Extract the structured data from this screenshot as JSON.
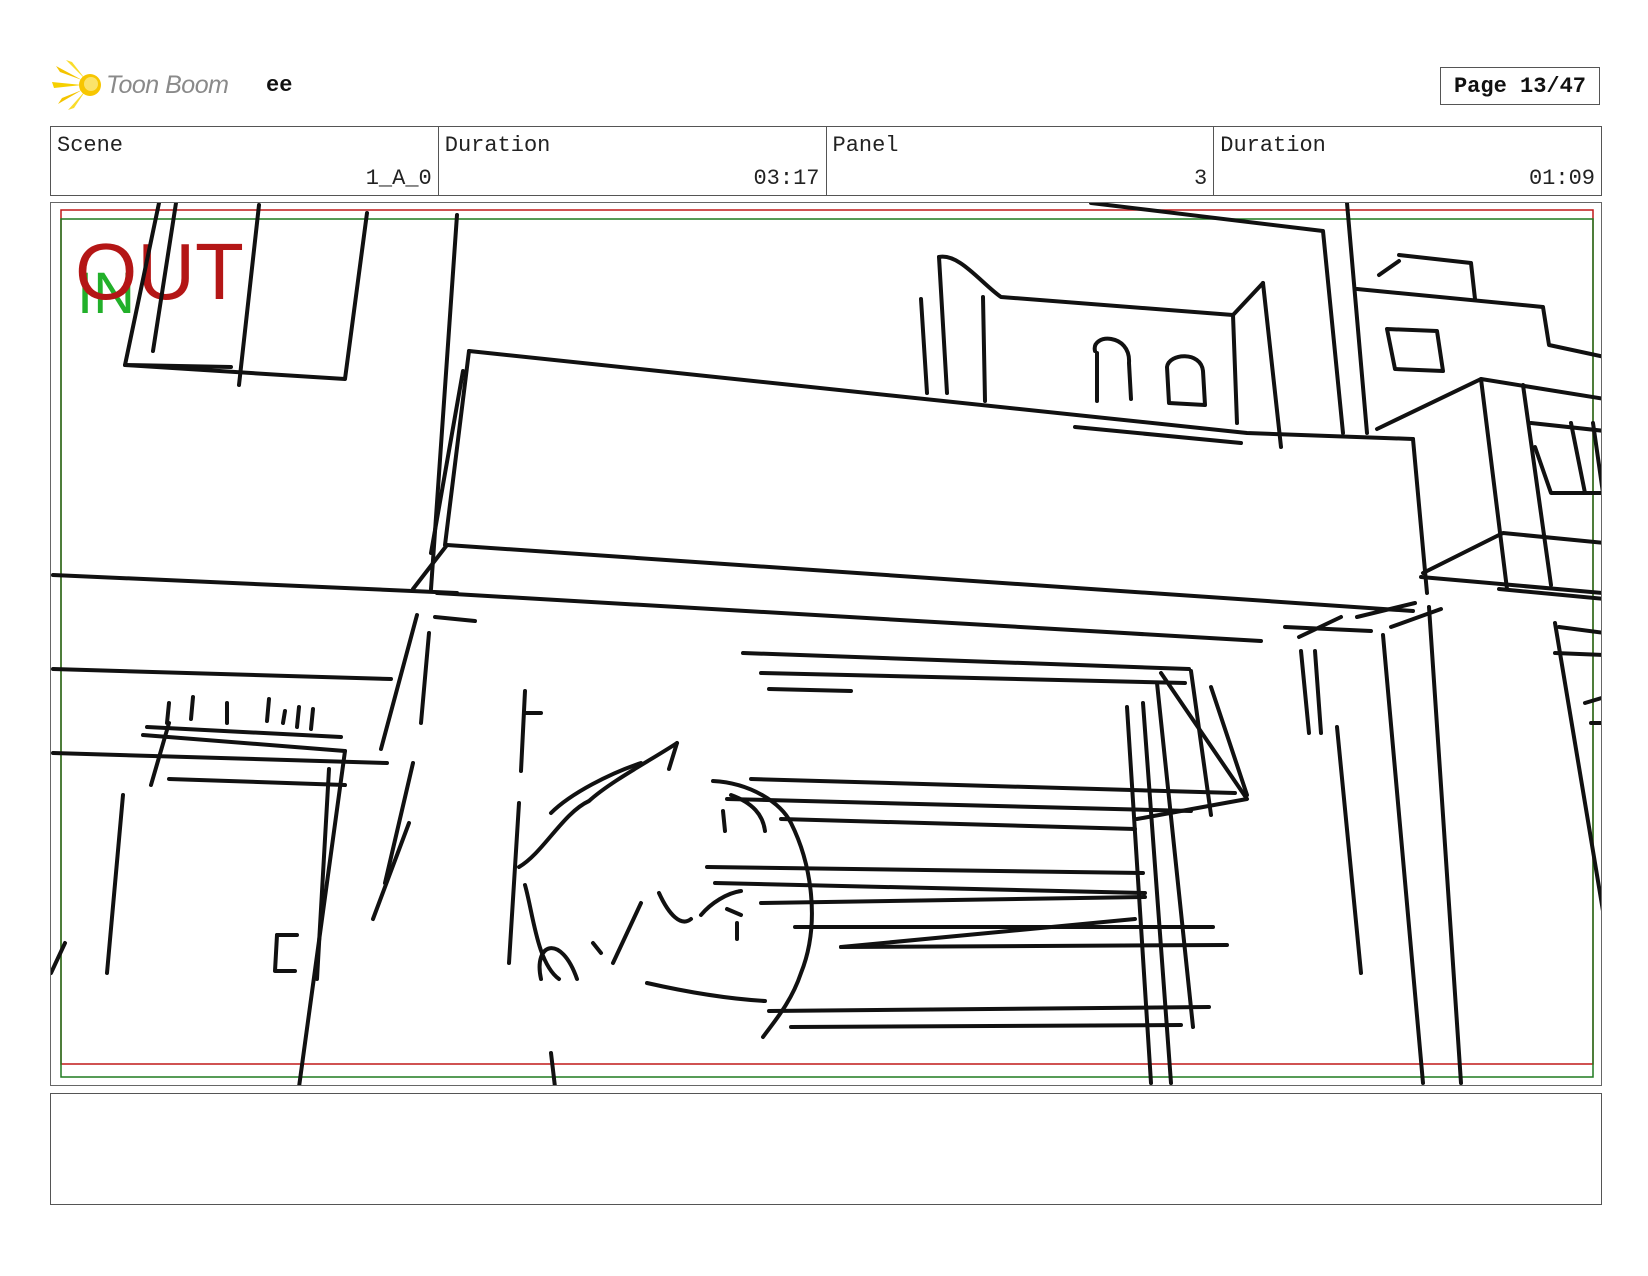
{
  "header": {
    "logo_text": "Toon Boom",
    "project_name": "ee",
    "page_label": "Page 13/47"
  },
  "info": [
    {
      "label": "Scene",
      "value": "1_A_0"
    },
    {
      "label": "Duration",
      "value": "03:17"
    },
    {
      "label": "Panel",
      "value": "3"
    },
    {
      "label": "Duration",
      "value": "01:09"
    }
  ],
  "panel": {
    "in_marker": "IN",
    "out_marker": "OUT",
    "in_color": "#22b02a",
    "out_color": "#b41616",
    "frame_outer_color": "#c01818",
    "frame_inner_color": "#1f7a1f"
  },
  "caption": {
    "text": ""
  }
}
